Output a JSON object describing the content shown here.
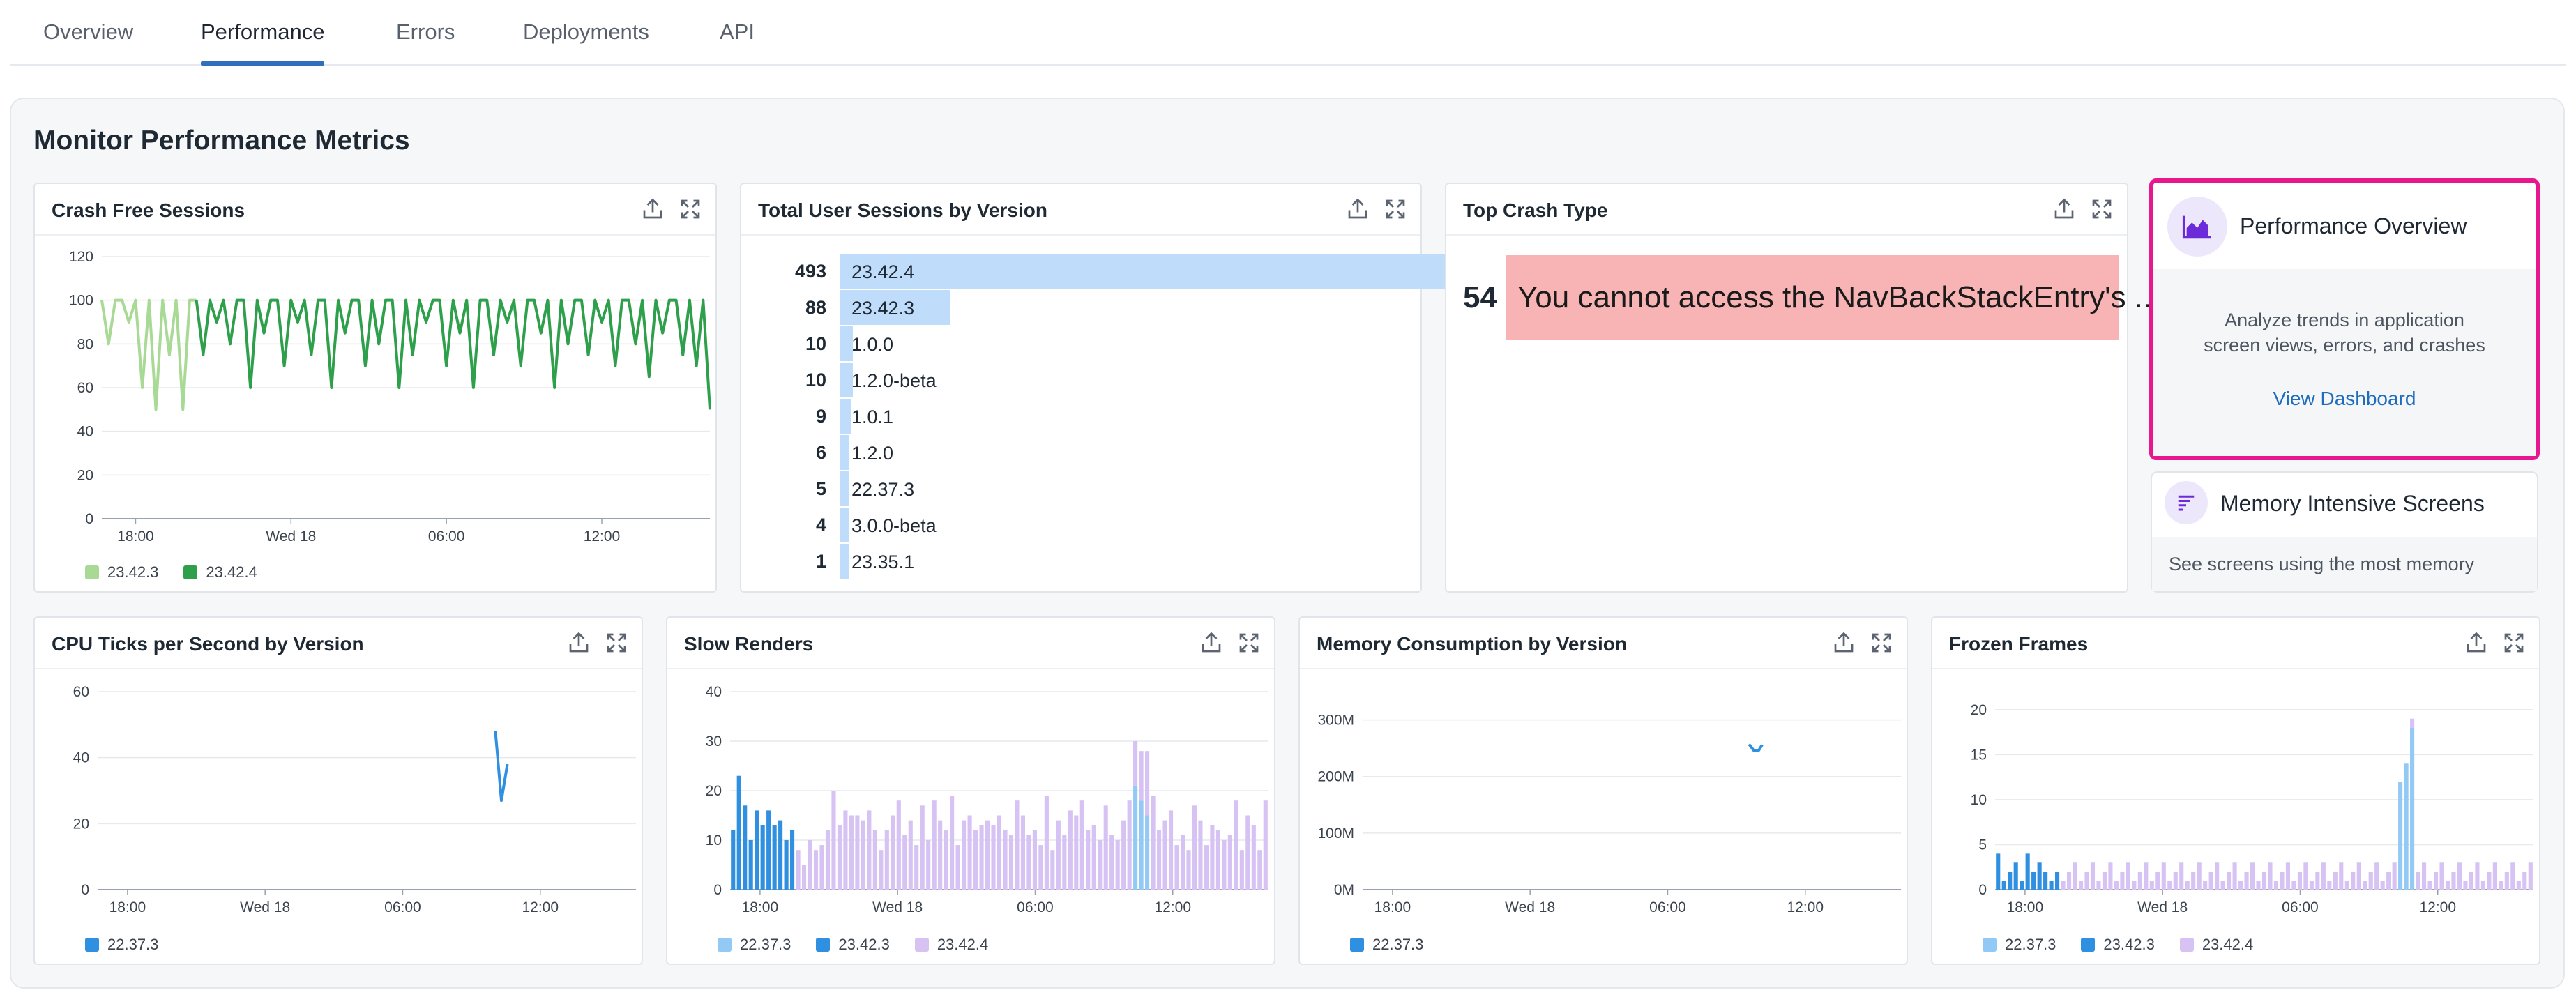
{
  "tabs": [
    {
      "label": "Overview",
      "active": false
    },
    {
      "label": "Performance",
      "active": true
    },
    {
      "label": "Errors",
      "active": false
    },
    {
      "label": "Deployments",
      "active": false
    },
    {
      "label": "API",
      "active": false
    }
  ],
  "page_title": "Monitor Performance Metrics",
  "colors": {
    "accent": "#2f6fbd",
    "highlight_border": "#e8178e",
    "green_light": "#a8da95",
    "green_dark": "#2e9f4b",
    "blue_light": "#93c9f5",
    "blue_dark": "#2f8fe0",
    "purple_light": "#d6c2f3",
    "crash_bar": "#f8b4b4",
    "version_bar": "#bfdcfb",
    "link": "#1f6cbd"
  },
  "card_icons": [
    "export-icon",
    "expand-icon"
  ],
  "crash_free": {
    "title": "Crash Free Sessions",
    "legend": [
      "23.42.3",
      "23.42.4"
    ]
  },
  "sessions_by_version": {
    "title": "Total User Sessions by Version",
    "rows": [
      {
        "count": "493",
        "version": "23.42.4",
        "value": 493
      },
      {
        "count": "88",
        "version": "23.42.3",
        "value": 88
      },
      {
        "count": "10",
        "version": "1.0.0",
        "value": 10
      },
      {
        "count": "10",
        "version": "1.2.0-beta",
        "value": 10
      },
      {
        "count": "9",
        "version": "1.0.1",
        "value": 9
      },
      {
        "count": "6",
        "version": "1.2.0",
        "value": 6
      },
      {
        "count": "5",
        "version": "22.37.3",
        "value": 5
      },
      {
        "count": "4",
        "version": "3.0.0-beta",
        "value": 4
      },
      {
        "count": "1",
        "version": "23.35.1",
        "value": 1
      }
    ]
  },
  "top_crash": {
    "title": "Top Crash Type",
    "count": "54",
    "text": "You cannot access the NavBackStackEntry's ..."
  },
  "perf_overview": {
    "icon": "area-chart-icon",
    "title": "Performance Overview",
    "desc_line1": "Analyze trends in application",
    "desc_line2": "screen views, errors, and crashes",
    "link": "View Dashboard"
  },
  "memory_screens": {
    "icon": "sort-list-icon",
    "title": "Memory Intensive Screens",
    "desc": "See screens using the most memory"
  },
  "cpu": {
    "title": "CPU Ticks per Second by Version",
    "legend": [
      "22.37.3"
    ]
  },
  "slow_renders": {
    "title": "Slow Renders",
    "legend": [
      "22.37.3",
      "23.42.3",
      "23.42.4"
    ]
  },
  "memory": {
    "title": "Memory Consumption by Version",
    "legend": [
      "22.37.3"
    ]
  },
  "frozen": {
    "title": "Frozen Frames",
    "legend": [
      "22.37.3",
      "23.42.3",
      "23.42.4"
    ]
  },
  "chart_data": [
    {
      "id": "crash_free_sessions",
      "type": "line",
      "title": "Crash Free Sessions",
      "yticks": [
        0,
        20,
        40,
        60,
        80,
        100,
        120
      ],
      "ylim": [
        0,
        120
      ],
      "xticks": [
        "18:00",
        "Wed 18",
        "06:00",
        "12:00"
      ],
      "xlim": [
        0,
        90
      ],
      "xtick_positions": [
        5,
        28,
        51,
        74
      ],
      "series": [
        {
          "name": "23.42.3",
          "color": "#a8da95",
          "x": [
            0,
            1,
            2,
            3,
            4,
            5,
            6,
            7,
            8,
            9,
            10,
            11,
            12,
            13,
            14
          ],
          "y": [
            100,
            80,
            100,
            100,
            90,
            100,
            60,
            100,
            50,
            100,
            75,
            100,
            50,
            100,
            100
          ]
        },
        {
          "name": "23.42.4",
          "color": "#2e9f4b",
          "x": [
            14,
            15,
            16,
            17,
            18,
            19,
            20,
            21,
            22,
            23,
            24,
            25,
            26,
            27,
            28,
            29,
            30,
            31,
            32,
            33,
            34,
            35,
            36,
            37,
            38,
            39,
            40,
            41,
            42,
            43,
            44,
            45,
            46,
            47,
            48,
            49,
            50,
            51,
            52,
            53,
            54,
            55,
            56,
            57,
            58,
            59,
            60,
            61,
            62,
            63,
            64,
            65,
            66,
            67,
            68,
            69,
            70,
            71,
            72,
            73,
            74,
            75,
            76,
            77,
            78,
            79,
            80,
            81,
            82,
            83,
            84,
            85,
            86,
            87,
            88,
            89,
            90
          ],
          "y": [
            100,
            75,
            100,
            90,
            100,
            80,
            100,
            100,
            60,
            100,
            85,
            100,
            100,
            70,
            100,
            90,
            100,
            75,
            100,
            100,
            60,
            100,
            85,
            100,
            100,
            70,
            100,
            80,
            100,
            100,
            60,
            100,
            75,
            100,
            90,
            100,
            100,
            70,
            100,
            85,
            100,
            60,
            100,
            100,
            75,
            100,
            90,
            100,
            70,
            100,
            100,
            85,
            100,
            60,
            100,
            80,
            100,
            100,
            75,
            100,
            90,
            100,
            70,
            100,
            100,
            80,
            100,
            65,
            100,
            85,
            100,
            100,
            75,
            100,
            70,
            100,
            50
          ]
        }
      ]
    },
    {
      "id": "sessions_by_version",
      "type": "bar",
      "title": "Total User Sessions by Version",
      "categories": [
        "23.42.4",
        "23.42.3",
        "1.0.0",
        "1.2.0-beta",
        "1.0.1",
        "1.2.0",
        "22.37.3",
        "3.0.0-beta",
        "23.35.1"
      ],
      "values": [
        493,
        88,
        10,
        10,
        9,
        6,
        5,
        4,
        1
      ]
    },
    {
      "id": "cpu_ticks",
      "type": "line",
      "title": "CPU Ticks per Second by Version",
      "yticks": [
        0,
        20,
        40,
        60
      ],
      "ylim": [
        0,
        60
      ],
      "xticks": [
        "18:00",
        "Wed 18",
        "06:00",
        "12:00"
      ],
      "xlim": [
        0,
        90
      ],
      "xtick_positions": [
        5,
        28,
        51,
        74
      ],
      "series": [
        {
          "name": "22.37.3",
          "color": "#2f8fe0",
          "x": [
            66.5,
            67.5,
            68.5
          ],
          "y": [
            48,
            27,
            38
          ]
        }
      ]
    },
    {
      "id": "slow_renders",
      "type": "bar",
      "title": "Slow Renders",
      "yticks": [
        0,
        10,
        20,
        30,
        40
      ],
      "ylim": [
        0,
        40
      ],
      "xticks": [
        "18:00",
        "Wed 18",
        "06:00",
        "12:00"
      ],
      "xlim": [
        0,
        90
      ],
      "xtick_positions": [
        5,
        28,
        51,
        74
      ],
      "series": [
        {
          "name": "22.37.3",
          "color": "#93c9f5",
          "values": [
            0,
            0,
            0,
            0,
            0,
            0,
            0,
            0,
            0,
            0,
            0,
            0,
            0,
            0,
            0,
            0,
            0,
            0,
            0,
            0,
            0,
            0,
            0,
            0,
            0,
            0,
            0,
            0,
            0,
            0,
            0,
            0,
            0,
            0,
            0,
            0,
            0,
            0,
            0,
            0,
            0,
            0,
            0,
            0,
            0,
            0,
            0,
            0,
            0,
            0,
            0,
            0,
            0,
            0,
            0,
            0,
            0,
            0,
            0,
            0,
            0,
            0,
            0,
            0,
            0,
            0,
            0,
            0,
            21,
            18,
            15,
            0,
            0,
            0,
            0,
            0,
            0,
            0,
            0,
            0,
            0,
            0,
            0,
            0,
            0,
            0,
            0,
            0,
            0,
            0,
            0
          ]
        },
        {
          "name": "23.42.3",
          "color": "#2f8fe0",
          "values": [
            12,
            23,
            17,
            10,
            16,
            13,
            16,
            13,
            14,
            10,
            12,
            0,
            0,
            0,
            0,
            0,
            0,
            0,
            0,
            0,
            0,
            0,
            0,
            0,
            0,
            0,
            0,
            0,
            0,
            0,
            0,
            0,
            0,
            0,
            0,
            0,
            0,
            0,
            0,
            0,
            0,
            0,
            0,
            0,
            0,
            0,
            0,
            0,
            0,
            0,
            0,
            0,
            0,
            0,
            0,
            0,
            0,
            0,
            0,
            0,
            0,
            0,
            0,
            0,
            0,
            0,
            0,
            0,
            0,
            0,
            0,
            0,
            0,
            0,
            0,
            0,
            0,
            0,
            0,
            0,
            0,
            0,
            0,
            0,
            0,
            0,
            0,
            0,
            0,
            0,
            0
          ]
        },
        {
          "name": "23.42.4",
          "color": "#d6c2f3",
          "values": [
            0,
            0,
            0,
            0,
            0,
            0,
            0,
            0,
            0,
            0,
            0,
            8,
            5,
            10,
            8,
            9,
            12,
            20,
            13,
            16,
            15,
            15,
            14,
            16,
            12,
            8,
            12,
            15,
            18,
            11,
            14,
            9,
            17,
            10,
            18,
            14,
            12,
            19,
            9,
            14,
            15,
            12,
            13,
            14,
            13,
            15,
            12,
            11,
            18,
            15,
            11,
            12,
            9,
            19,
            8,
            14,
            11,
            16,
            15,
            18,
            12,
            13,
            10,
            17,
            11,
            10,
            14,
            18,
            9,
            10,
            13,
            19,
            12,
            14,
            16,
            9,
            11,
            8,
            17,
            14,
            9,
            13,
            12,
            10,
            11,
            18,
            8,
            15,
            13,
            8,
            18
          ]
        }
      ]
    },
    {
      "id": "memory_consumption",
      "type": "line",
      "title": "Memory Consumption by Version",
      "yticks": [
        0,
        100,
        200,
        300
      ],
      "ytick_labels": [
        "0M",
        "100M",
        "200M",
        "300M"
      ],
      "ylim": [
        0,
        350
      ],
      "xticks": [
        "18:00",
        "Wed 18",
        "06:00",
        "12:00"
      ],
      "xlim": [
        0,
        90
      ],
      "xtick_positions": [
        5,
        28,
        51,
        74
      ],
      "series": [
        {
          "name": "22.37.3",
          "color": "#2f8fe0",
          "x": [
            64.6,
            65.4,
            66.2,
            66.8
          ],
          "y": [
            257,
            246,
            246,
            256
          ]
        }
      ]
    },
    {
      "id": "frozen_frames",
      "type": "bar",
      "title": "Frozen Frames",
      "yticks": [
        0,
        5,
        10,
        15,
        20
      ],
      "ylim": [
        0,
        22
      ],
      "xticks": [
        "18:00",
        "Wed 18",
        "06:00",
        "12:00"
      ],
      "xlim": [
        0,
        90
      ],
      "xtick_positions": [
        5,
        28,
        51,
        74
      ],
      "series": [
        {
          "name": "22.37.3",
          "color": "#93c9f5",
          "values": [
            0,
            0,
            0,
            0,
            0,
            0,
            0,
            0,
            0,
            0,
            0,
            0,
            0,
            0,
            0,
            0,
            0,
            0,
            0,
            0,
            0,
            0,
            0,
            0,
            0,
            0,
            0,
            0,
            0,
            0,
            0,
            0,
            0,
            0,
            0,
            0,
            0,
            0,
            0,
            0,
            0,
            0,
            0,
            0,
            0,
            0,
            0,
            0,
            0,
            0,
            0,
            0,
            0,
            0,
            0,
            0,
            0,
            0,
            0,
            0,
            0,
            0,
            0,
            0,
            0,
            0,
            0,
            0,
            12,
            14,
            18,
            0,
            0,
            0,
            0,
            0,
            0,
            0,
            0,
            0,
            0,
            0,
            0,
            0,
            0,
            0,
            0,
            0,
            0,
            0,
            0
          ]
        },
        {
          "name": "23.42.3",
          "color": "#2f8fe0",
          "values": [
            4,
            1,
            2,
            3,
            1,
            4,
            2,
            3,
            2,
            1,
            2,
            0,
            0,
            0,
            0,
            0,
            0,
            0,
            0,
            0,
            0,
            0,
            0,
            0,
            0,
            0,
            0,
            0,
            0,
            0,
            0,
            0,
            0,
            0,
            0,
            0,
            0,
            0,
            0,
            0,
            0,
            0,
            0,
            0,
            0,
            0,
            0,
            0,
            0,
            0,
            0,
            0,
            0,
            0,
            0,
            0,
            0,
            0,
            0,
            0,
            0,
            0,
            0,
            0,
            0,
            0,
            0,
            0,
            0,
            0,
            0,
            0,
            0,
            0,
            0,
            0,
            0,
            0,
            0,
            0,
            0,
            0,
            0,
            0,
            0,
            0,
            0,
            0,
            0,
            0,
            0
          ]
        },
        {
          "name": "23.42.4",
          "color": "#d6c2f3",
          "values": [
            0,
            0,
            0,
            0,
            0,
            0,
            0,
            0,
            0,
            0,
            0,
            1,
            2,
            3,
            1,
            2,
            3,
            1,
            2,
            3,
            1,
            2,
            3,
            1,
            2,
            3,
            1,
            2,
            3,
            1,
            2,
            3,
            1,
            2,
            3,
            1,
            2,
            3,
            1,
            2,
            3,
            1,
            2,
            3,
            1,
            2,
            3,
            1,
            2,
            3,
            1,
            2,
            3,
            1,
            2,
            3,
            1,
            2,
            3,
            1,
            2,
            3,
            1,
            2,
            3,
            1,
            2,
            3,
            0,
            0,
            1,
            2,
            3,
            1,
            2,
            3,
            1,
            2,
            3,
            1,
            2,
            3,
            1,
            2,
            3,
            1,
            2,
            3,
            1,
            2,
            3
          ]
        }
      ]
    }
  ]
}
